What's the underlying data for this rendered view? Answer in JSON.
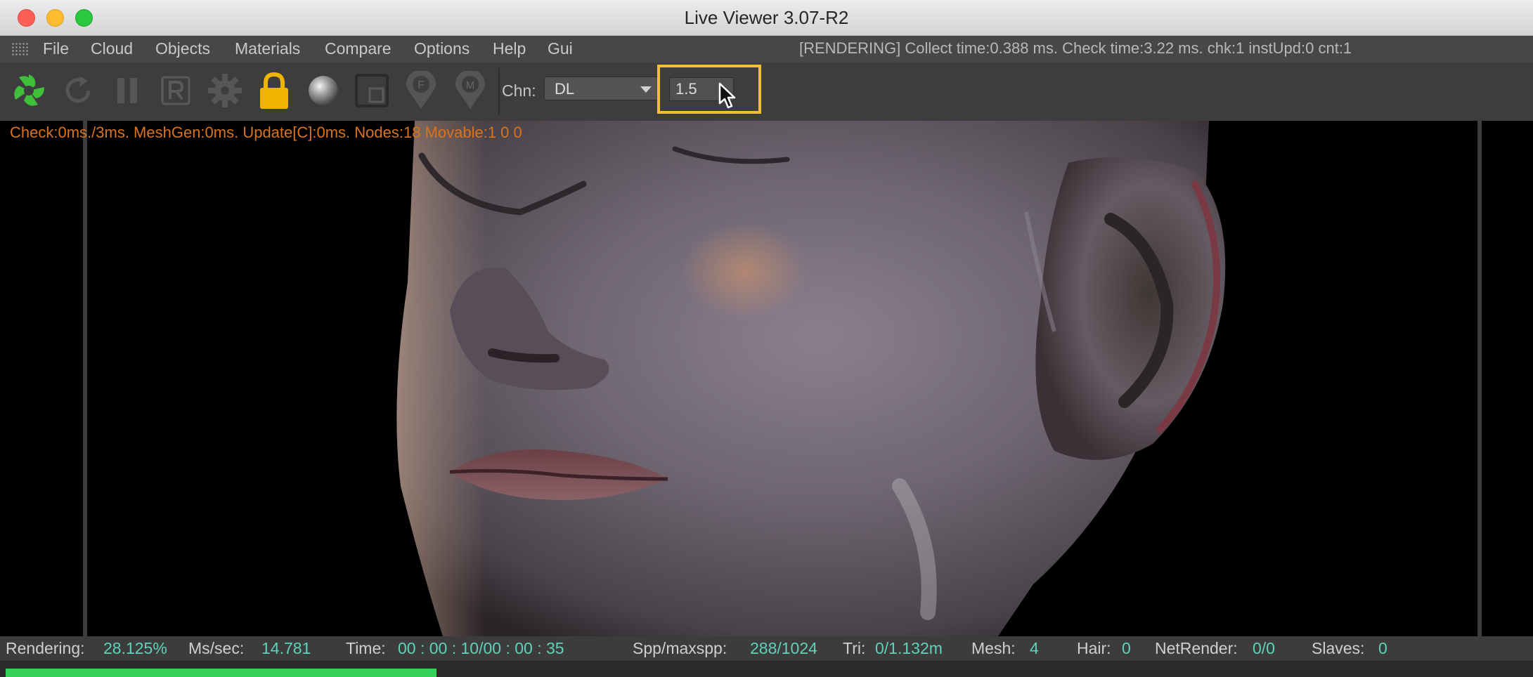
{
  "window": {
    "title": "Live Viewer 3.07-R2"
  },
  "menu": {
    "items": [
      "File",
      "Cloud",
      "Objects",
      "Materials",
      "Compare",
      "Options",
      "Help",
      "Gui"
    ],
    "render_status": "[RENDERING] Collect time:0.388 ms.  Check time:3.22 ms.  chk:1  instUpd:0  cnt:1"
  },
  "toolbar": {
    "icons": [
      "octane-logo-icon",
      "refresh-icon",
      "pause-icon",
      "r-icon",
      "gear-icon",
      "lock-icon",
      "material-ball-icon",
      "region-icon",
      "focus-pin-icon",
      "material-pin-icon"
    ],
    "channel_label": "Chn:",
    "channel_value": "DL",
    "input_value": "1.5"
  },
  "viewport": {
    "debug_text": "Check:0ms./3ms. MeshGen:0ms. Update[C]:0ms. Nodes:18 Movable:1  0 0"
  },
  "status": {
    "rendering_label": "Rendering:",
    "rendering_value": "28.125%",
    "mssec_label": "Ms/sec:",
    "mssec_value": "14.781",
    "time_label": "Time:",
    "time_value": "00 : 00 : 10/00 : 00 : 35",
    "spp_label": "Spp/maxspp:",
    "spp_value": "288/1024",
    "tri_label": "Tri:",
    "tri_value": "0/1.132m",
    "mesh_label": "Mesh:",
    "mesh_value": "4",
    "hair_label": "Hair:",
    "hair_value": "0",
    "net_label": "NetRender:",
    "net_value": "0/0",
    "slaves_label": "Slaves:",
    "slaves_value": "0",
    "progress_fraction": 0.28125
  },
  "colors": {
    "accent_yellow": "#f2c12e",
    "progress_green": "#38d25a",
    "status_value": "#5ed3b8",
    "debug_orange": "#d9731c"
  }
}
